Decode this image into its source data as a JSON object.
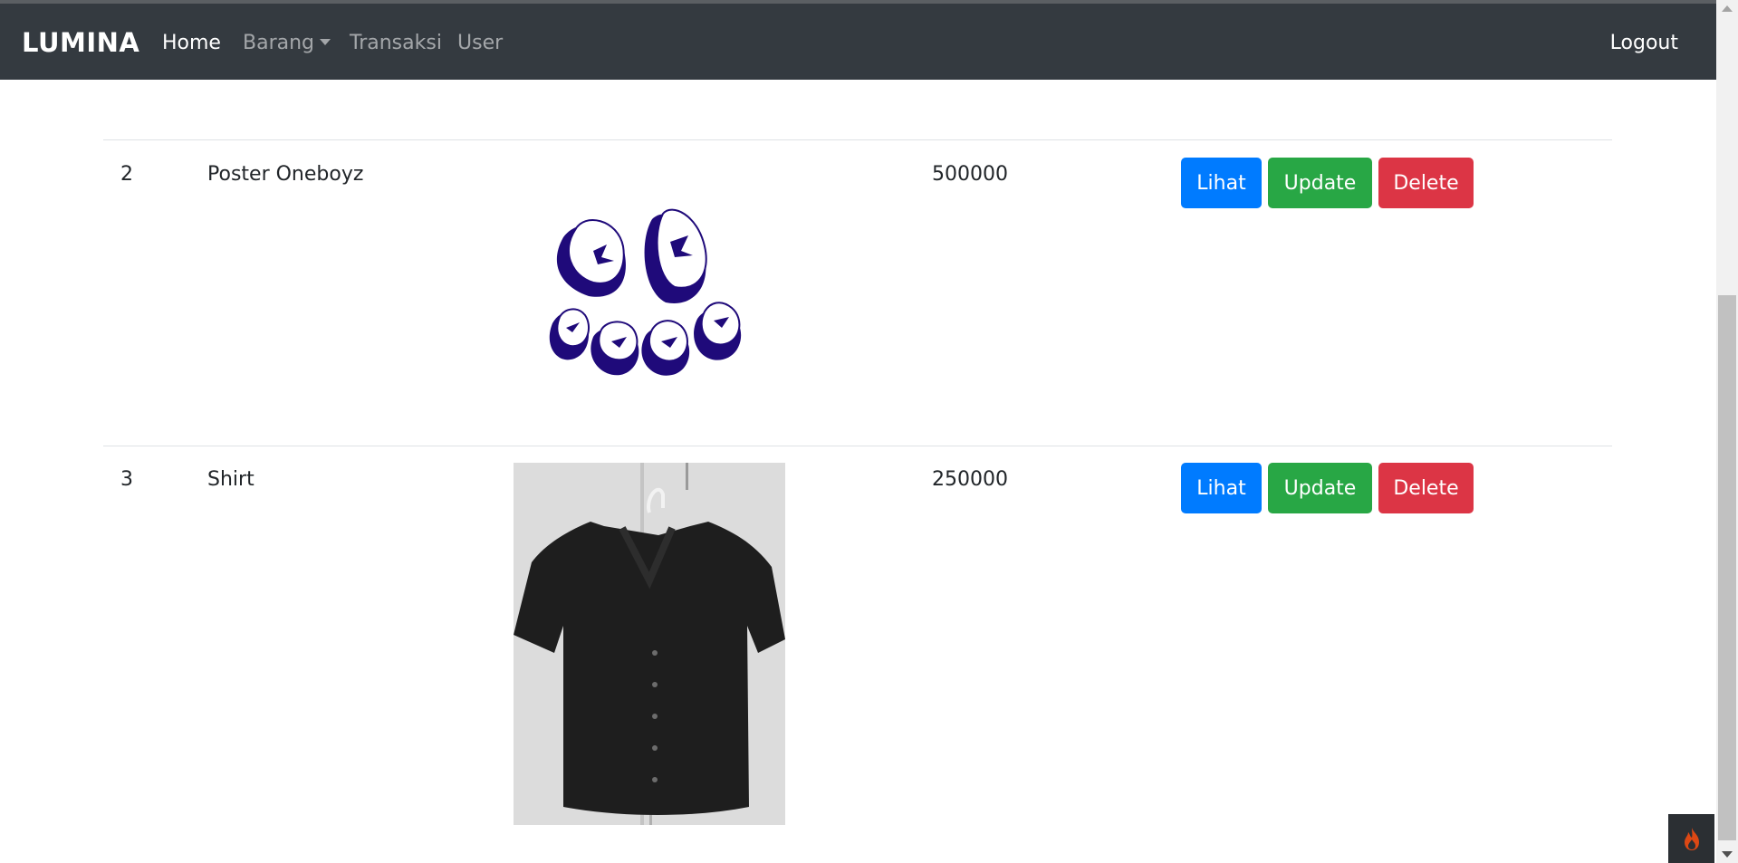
{
  "navbar": {
    "brand": "LUMINA",
    "links": [
      {
        "label": "Home",
        "active": true
      },
      {
        "label": "Barang",
        "dropdown": true
      },
      {
        "label": "Transaksi"
      },
      {
        "label": "User"
      }
    ],
    "logout": "Logout",
    "bg_color": "#343a40"
  },
  "table": {
    "rows": [
      {
        "no": "2",
        "name": "Poster Oneboyz",
        "image": "poster-oneboyz-logo",
        "price": "500000",
        "actions": [
          "Lihat",
          "Update",
          "Delete"
        ]
      },
      {
        "no": "3",
        "name": "Shirt",
        "image": "black-knit-shirt-photo",
        "price": "250000",
        "actions": [
          "Lihat",
          "Update",
          "Delete"
        ]
      }
    ]
  },
  "colors": {
    "lihat": "#007bff",
    "update": "#28a745",
    "delete": "#dc3545",
    "poster_ink": "#1f0a7a"
  }
}
